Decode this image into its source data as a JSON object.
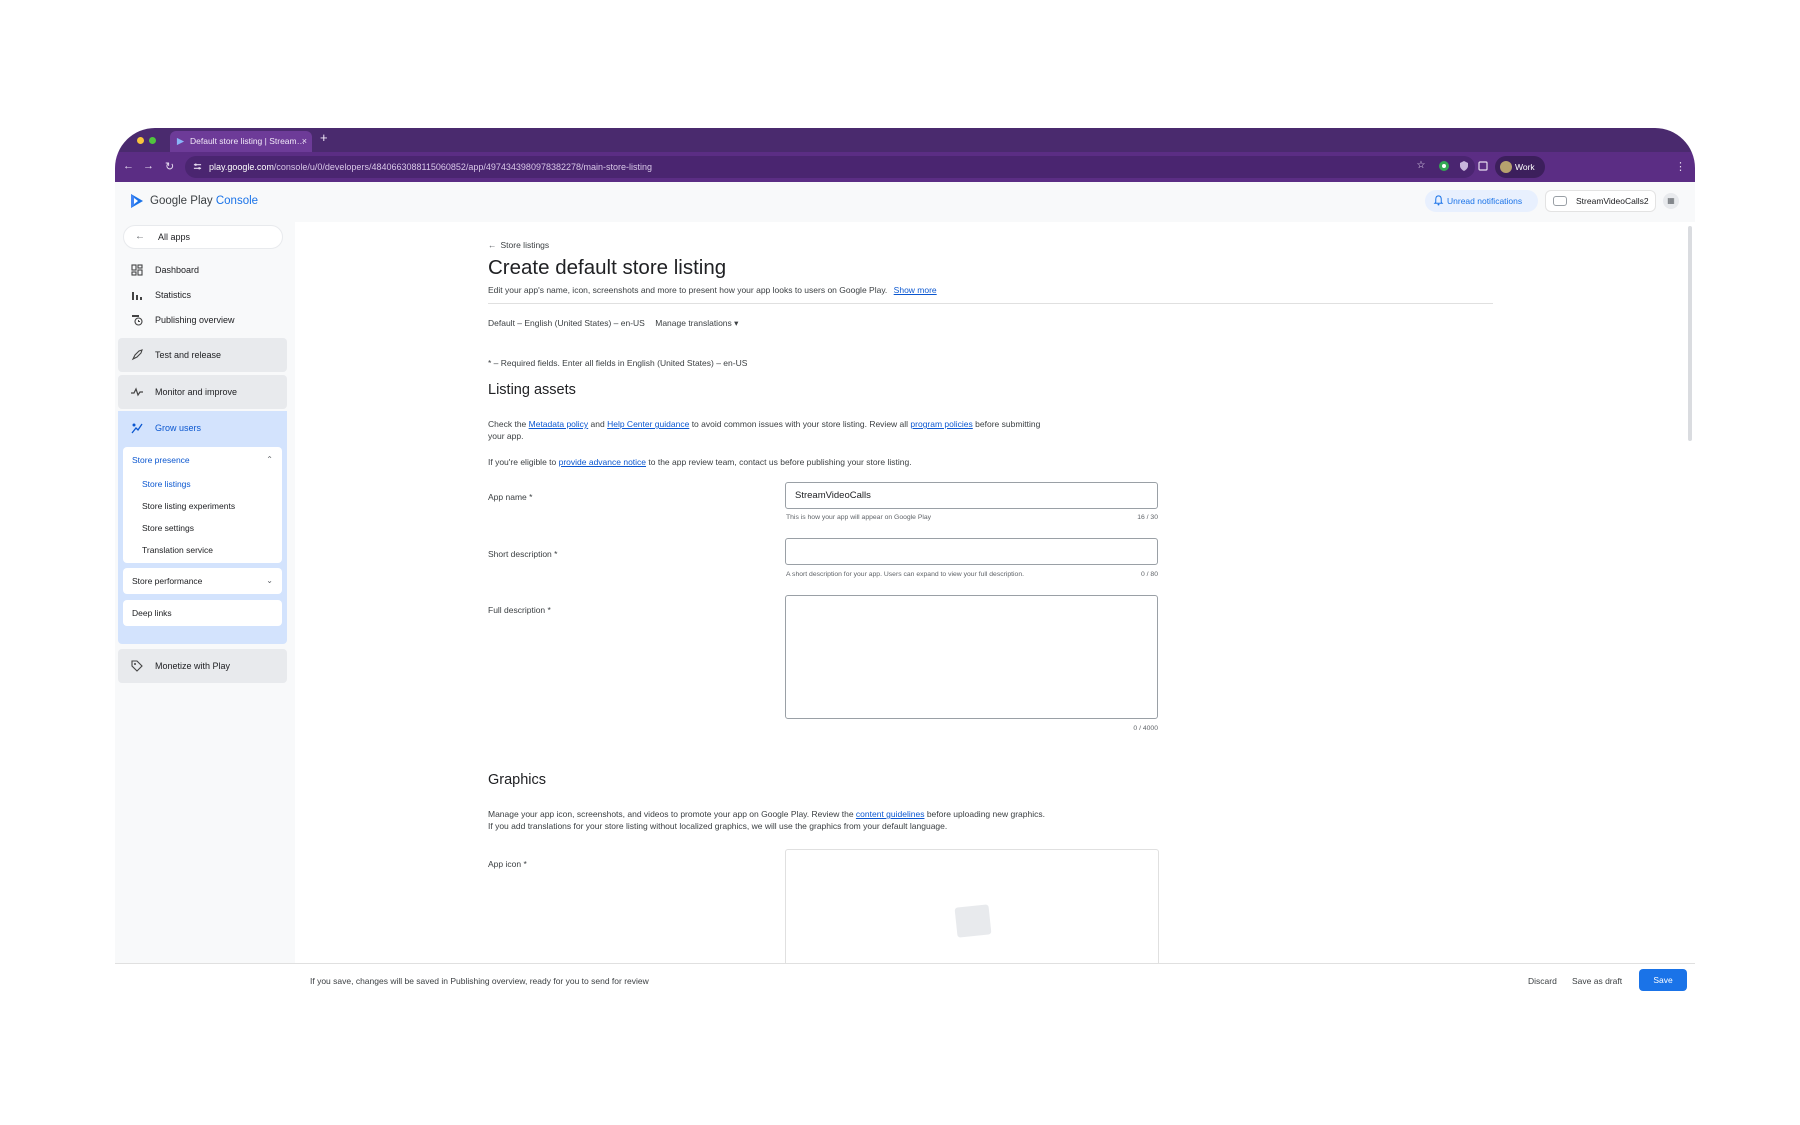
{
  "browser": {
    "tab_title": "Default store listing | Stream…",
    "tab_close": "×",
    "new_tab": "+",
    "url_host": "play.google.com",
    "url_path": "/console/u/0/developers/4840663088115060852/app/4974343980978382278/main-store-listing",
    "profile": "Work"
  },
  "header": {
    "logo_main": "Google Play ",
    "logo_accent": "Console",
    "unread_notifications": "Unread notifications",
    "account_name": "StreamVideoCalls2"
  },
  "sidebar": {
    "all_apps": "All apps",
    "items": [
      {
        "label": "Dashboard",
        "icon": "dashboard-icon"
      },
      {
        "label": "Statistics",
        "icon": "bar-chart-icon"
      },
      {
        "label": "Publishing overview",
        "icon": "publishing-clock-icon"
      }
    ],
    "groups": [
      {
        "label": "Test and release",
        "icon": "rocket-icon"
      },
      {
        "label": "Monitor and improve",
        "icon": "pulse-icon"
      },
      {
        "label": "Grow users",
        "icon": "grow-icon"
      },
      {
        "label": "Monetize with Play",
        "icon": "tag-icon"
      }
    ],
    "store_presence": {
      "title": "Store presence",
      "links": [
        "Store listings",
        "Store listing experiments",
        "Store settings",
        "Translation service"
      ]
    },
    "store_performance": "Store performance",
    "deep_links": "Deep links"
  },
  "main": {
    "breadcrumb": "Store listings",
    "title": "Create default store listing",
    "subtitle": "Edit your app's name, icon, screenshots and more to present how your app looks to users on Google Play.",
    "show_more": "Show more",
    "default_language": "Default – English (United States) – en-US",
    "manage_translations": "Manage translations",
    "required_note": "* – Required fields. Enter all fields in English (United States) – en-US",
    "listing_assets": {
      "title": "Listing assets",
      "para1_a": "Check the ",
      "metadata_policy": "Metadata policy",
      "para1_b": " and ",
      "help_center": "Help Center guidance",
      "para1_c": " to avoid common issues with your store listing. Review all ",
      "program_policies": "program policies",
      "para1_d": " before submitting your app.",
      "para2_a": "If you're eligible to ",
      "advance_notice": "provide advance notice",
      "para2_b": " to the app review team, contact us before publishing your store listing."
    },
    "fields": {
      "app_name_label": "App name  *",
      "app_name_value": "StreamVideoCalls",
      "app_name_helper": "This is how your app will appear on Google Play",
      "app_name_counter": "16 / 30",
      "short_desc_label": "Short description  *",
      "short_desc_value": "",
      "short_desc_helper": "A short description for your app. Users can expand to view your full description.",
      "short_desc_counter": "0 / 80",
      "full_desc_label": "Full description  *",
      "full_desc_counter": "0 / 4000"
    },
    "graphics": {
      "title": "Graphics",
      "para_a": "Manage your app icon, screenshots, and videos to promote your app on Google Play. Review the ",
      "content_guidelines": "content guidelines",
      "para_b": " before uploading new graphics. If you add translations for your store listing without localized graphics, we will use the graphics from your default language.",
      "app_icon_label": "App icon  *"
    }
  },
  "footer": {
    "message": "If you save, changes will be saved in Publishing overview, ready for you to send for review",
    "discard": "Discard",
    "save_draft": "Save as draft",
    "save": "Save"
  }
}
